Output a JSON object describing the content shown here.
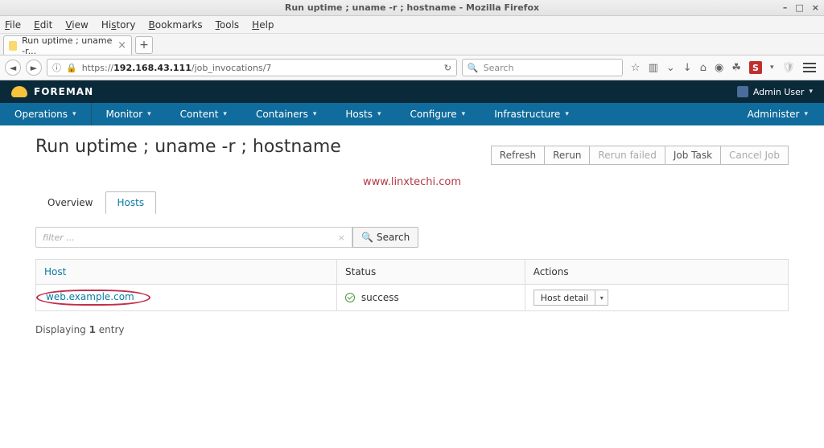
{
  "window": {
    "title": "Run uptime ; uname -r ; hostname - Mozilla Firefox"
  },
  "menubar": {
    "file": "File",
    "edit": "Edit",
    "view": "View",
    "history": "History",
    "bookmarks": "Bookmarks",
    "tools": "Tools",
    "help": "Help"
  },
  "browser_tab": {
    "title": "Run uptime ; uname -r..."
  },
  "url": {
    "scheme": "https://",
    "host": "192.168.43.111",
    "path": "/job_invocations/7"
  },
  "searchbox": {
    "placeholder": "Search"
  },
  "brand": {
    "name": "FOREMAN"
  },
  "user": {
    "label": "Admin User"
  },
  "nav": {
    "operations": "Operations",
    "monitor": "Monitor",
    "content": "Content",
    "containers": "Containers",
    "hosts": "Hosts",
    "configure": "Configure",
    "infrastructure": "Infrastructure",
    "administer": "Administer"
  },
  "page": {
    "title": "Run uptime ; uname -r ; hostname",
    "watermark": "www.linxtechi.com"
  },
  "actions": {
    "refresh": "Refresh",
    "rerun": "Rerun",
    "rerun_failed": "Rerun failed",
    "job_task": "Job Task",
    "cancel_job": "Cancel Job"
  },
  "tabs": {
    "overview": "Overview",
    "hosts": "Hosts"
  },
  "filter": {
    "placeholder": "filter ...",
    "search_label": "Search"
  },
  "table": {
    "headers": {
      "host": "Host",
      "status": "Status",
      "actions": "Actions"
    },
    "rows": [
      {
        "host": "web.example.com",
        "status": "success",
        "action": "Host detail"
      }
    ]
  },
  "footer": {
    "displaying_pre": "Displaying ",
    "count": "1",
    "displaying_post": " entry"
  }
}
